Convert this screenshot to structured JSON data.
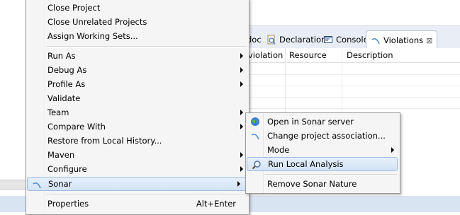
{
  "views": {
    "tabs": [
      {
        "label": "doc"
      },
      {
        "label": "Declaration"
      },
      {
        "label": "Console"
      },
      {
        "label": "Violations"
      }
    ],
    "close_glyph": "⊠"
  },
  "table": {
    "columns": [
      "violation",
      "Resource",
      "Description"
    ]
  },
  "context_menu": {
    "items": [
      {
        "label": "Close Project"
      },
      {
        "label": "Close Unrelated Projects"
      },
      {
        "label": "Assign Working Sets..."
      },
      {
        "label": "Run As"
      },
      {
        "label": "Debug As"
      },
      {
        "label": "Profile As"
      },
      {
        "label": "Validate"
      },
      {
        "label": "Team"
      },
      {
        "label": "Compare With"
      },
      {
        "label": "Restore from Local History..."
      },
      {
        "label": "Maven"
      },
      {
        "label": "Configure"
      },
      {
        "label": "Sonar"
      },
      {
        "label": "Properties",
        "shortcut": "Alt+Enter"
      }
    ]
  },
  "sonar_submenu": {
    "items": [
      {
        "label": "Open in Sonar server"
      },
      {
        "label": "Change project association..."
      },
      {
        "label": "Mode"
      },
      {
        "label": "Run Local Analysis"
      },
      {
        "label": "Remove Sonar Nature"
      }
    ]
  },
  "colors": {
    "menu_bg": "#f5f5f5",
    "highlight_border": "#9fbde0",
    "views_bar_bg": "#e9eef6"
  }
}
